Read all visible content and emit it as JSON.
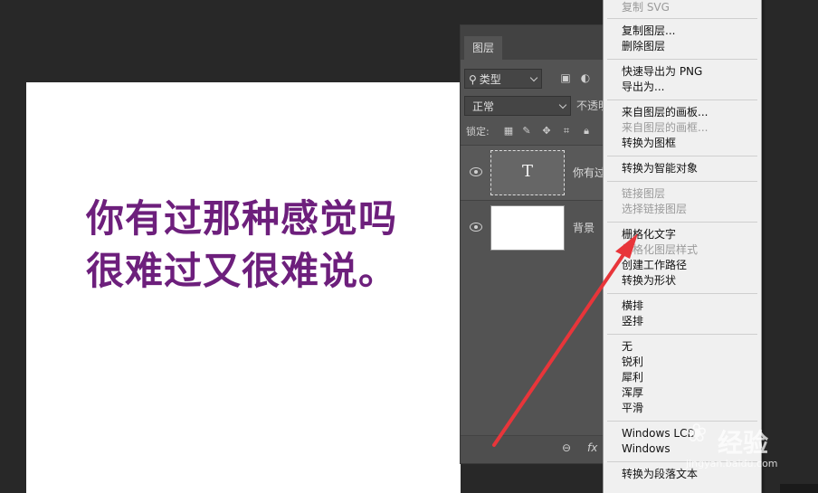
{
  "canvas": {
    "lines": [
      "你有过那种感觉吗",
      "很难过又很难说。"
    ],
    "text_color": "#6d1f7c"
  },
  "layers_panel": {
    "tab_label": "图层",
    "filter_label": "类型",
    "blend_mode": "正常",
    "opacity_label": "不透明",
    "lock_label": "锁定:",
    "layers": [
      {
        "name": "你有过",
        "type": "text",
        "thumb_glyph": "T"
      },
      {
        "name": "背景",
        "type": "image"
      }
    ],
    "footer_fx": "fx"
  },
  "context_menu": {
    "items": [
      {
        "label": "复制 SVG",
        "disabled": true
      },
      {
        "label": "复制图层...",
        "disabled": false
      },
      {
        "label": "删除图层",
        "disabled": false
      },
      {
        "label": "快速导出为 PNG",
        "disabled": false
      },
      {
        "label": "导出为...",
        "disabled": false
      },
      {
        "label": "来自图层的画板...",
        "disabled": false
      },
      {
        "label": "来自图层的画框...",
        "disabled": true
      },
      {
        "label": "转换为图框",
        "disabled": false
      },
      {
        "label": "转换为智能对象",
        "disabled": false
      },
      {
        "label": "链接图层",
        "disabled": true
      },
      {
        "label": "选择链接图层",
        "disabled": true
      },
      {
        "label": "栅格化文字",
        "disabled": false
      },
      {
        "label": "栅格化图层样式",
        "disabled": true
      },
      {
        "label": "创建工作路径",
        "disabled": false
      },
      {
        "label": "转换为形状",
        "disabled": false
      },
      {
        "label": "横排",
        "disabled": false
      },
      {
        "label": "竖排",
        "disabled": false
      },
      {
        "label": "无",
        "disabled": false
      },
      {
        "label": "锐利",
        "disabled": false
      },
      {
        "label": "犀利",
        "disabled": false
      },
      {
        "label": "浑厚",
        "disabled": false
      },
      {
        "label": "平滑",
        "disabled": false
      },
      {
        "label": "Windows LCD",
        "disabled": false
      },
      {
        "label": "Windows",
        "disabled": false
      },
      {
        "label": "转换为段落文本",
        "disabled": false
      }
    ]
  },
  "annotation": {
    "arrow_color": "#e8353a"
  },
  "watermark": {
    "text": "经验",
    "url": "jingyan.baidu.com"
  }
}
